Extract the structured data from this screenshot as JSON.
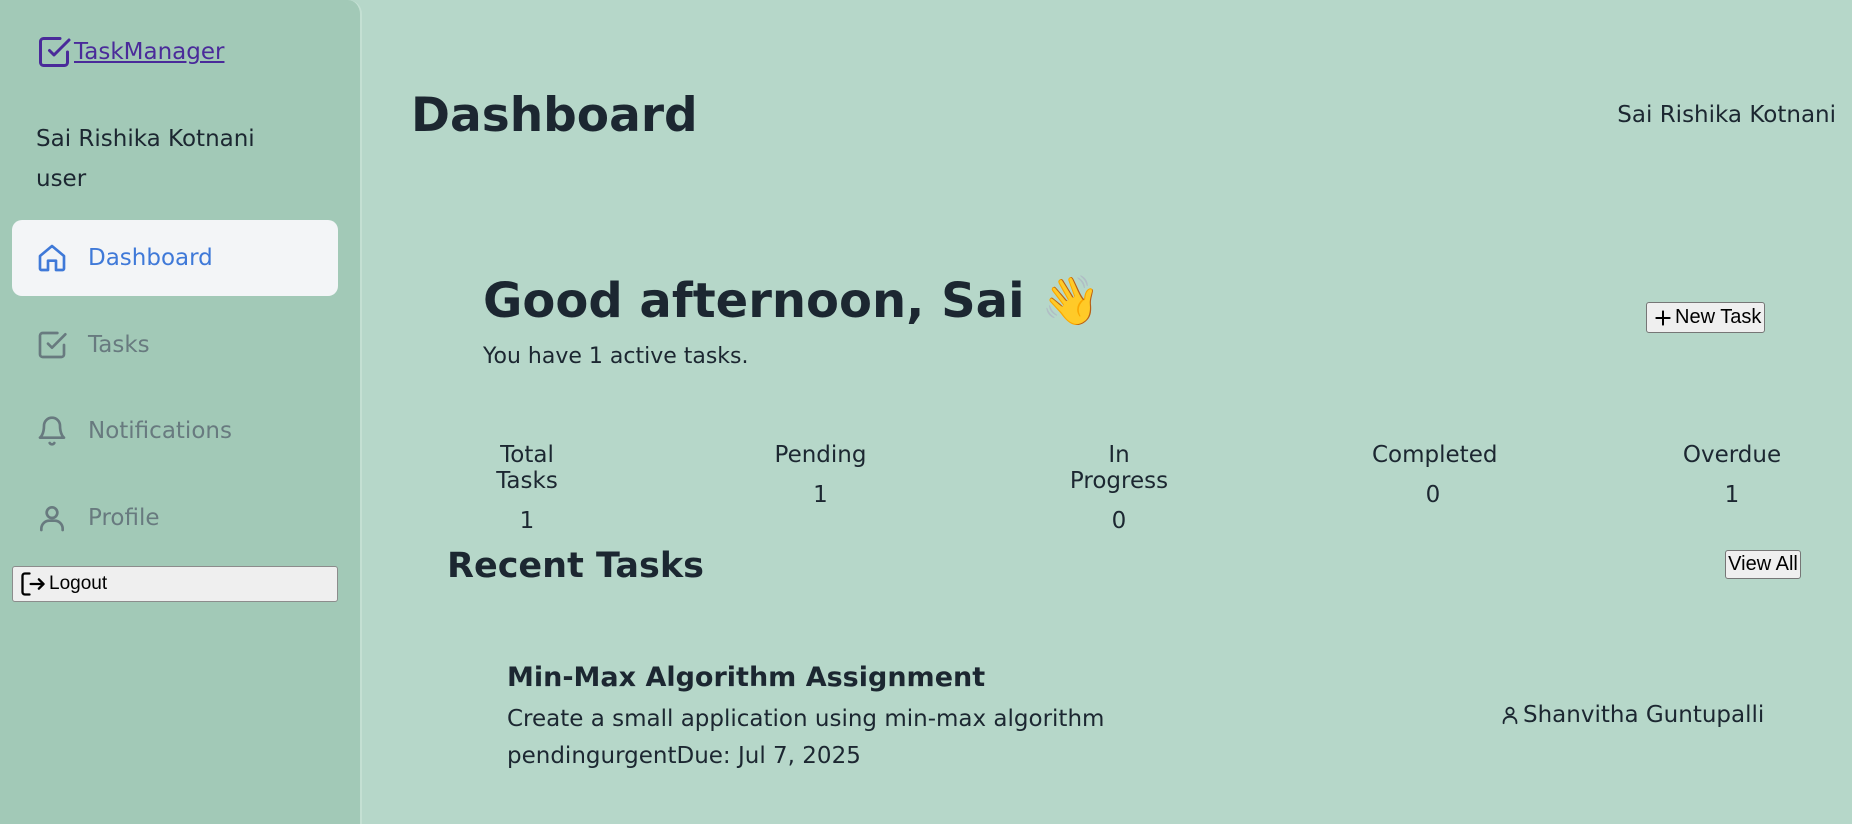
{
  "app": {
    "name": "TaskManager",
    "accent": "#3f79d8"
  },
  "sidebar": {
    "user_name": "Sai Rishika Kotnani",
    "user_role": "user",
    "items": [
      {
        "label": "Dashboard",
        "icon": "home-icon",
        "active": true
      },
      {
        "label": "Tasks",
        "icon": "check-square-icon",
        "active": false
      },
      {
        "label": "Notifications",
        "icon": "bell-icon",
        "active": false
      },
      {
        "label": "Profile",
        "icon": "user-icon",
        "active": false
      }
    ],
    "logout_label": "Logout"
  },
  "header": {
    "title": "Dashboard",
    "user_name": "Sai Rishika Kotnani"
  },
  "welcome": {
    "greeting": "Good afternoon, Sai 👋",
    "subtitle": "You have 1 active tasks.",
    "new_task_label": "New Task"
  },
  "stats": [
    {
      "label": "Total Tasks",
      "value": "1"
    },
    {
      "label": "Pending",
      "value": "1"
    },
    {
      "label": "In Progress",
      "value": "0"
    },
    {
      "label": "Completed",
      "value": "0"
    },
    {
      "label": "Overdue",
      "value": "1"
    }
  ],
  "recent": {
    "title": "Recent Tasks",
    "view_all_label": "View All",
    "tasks": [
      {
        "title": "Min-Max Algorithm Assignment",
        "description": "Create a small application using min-max algorithm",
        "status": "pending",
        "priority": "urgent",
        "due": "Due: Jul 7, 2025",
        "assignee": "Shanvitha Guntupalli"
      }
    ]
  }
}
